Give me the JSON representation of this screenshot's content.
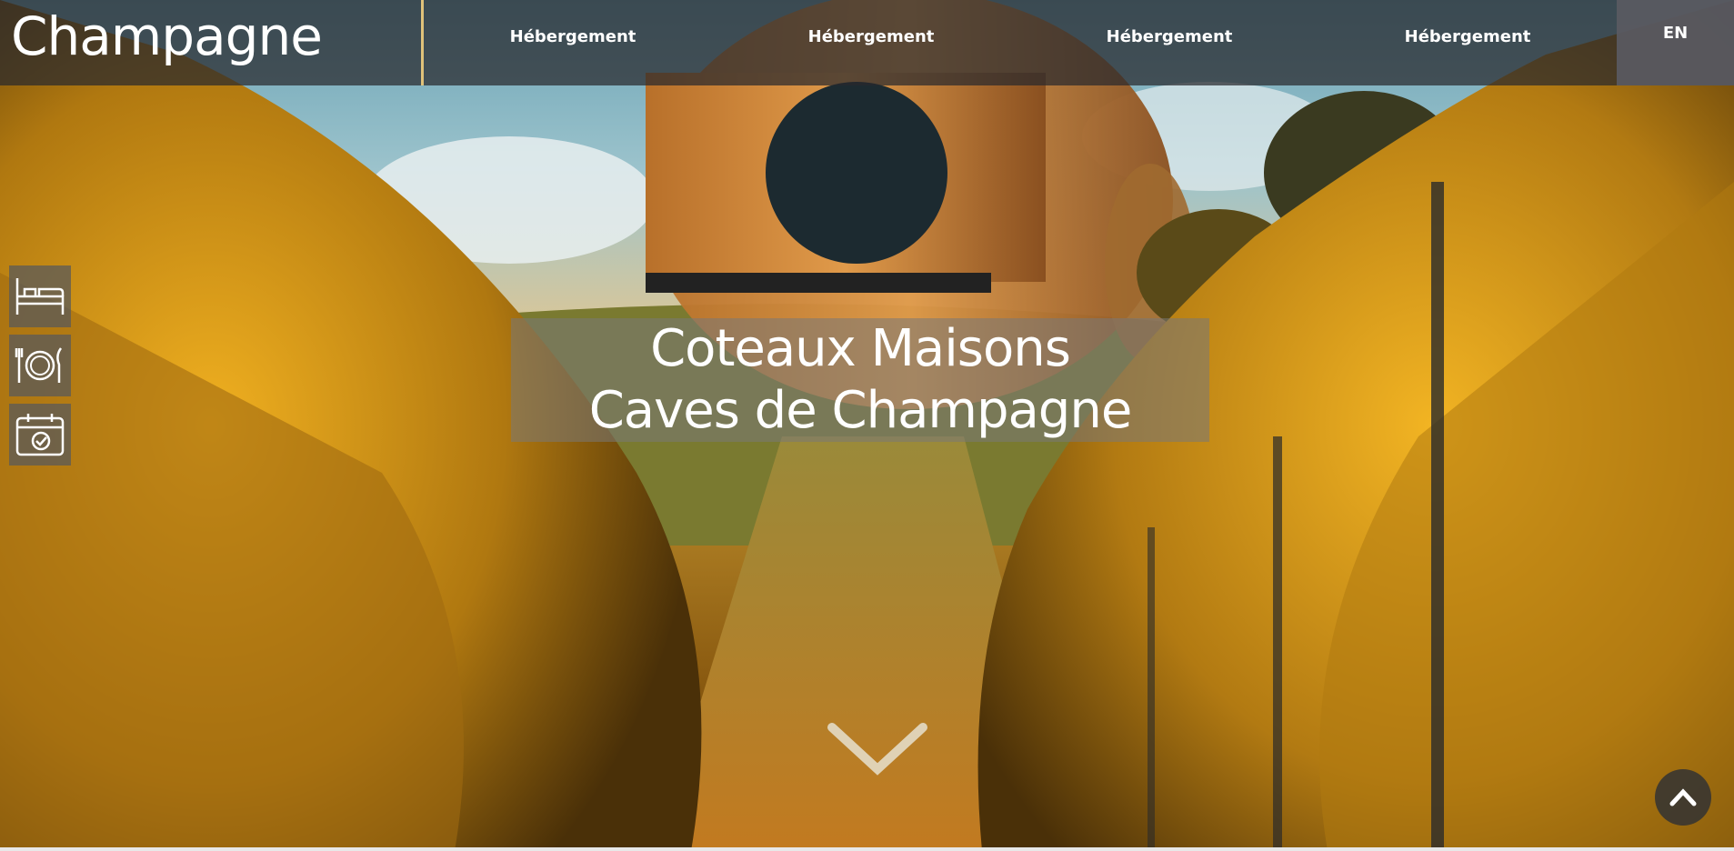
{
  "header": {
    "brand": "Champagne",
    "nav": [
      "Hébergement",
      "Hébergement",
      "Hébergement",
      "Hébergement"
    ],
    "lang": "EN"
  },
  "quick_links": [
    {
      "icon": "bed-icon"
    },
    {
      "icon": "plate-cutlery-icon"
    },
    {
      "icon": "calendar-check-icon"
    }
  ],
  "hero": {
    "title_line1": "Coteaux Maisons",
    "title_line2": "Caves de Champagne"
  },
  "controls": {
    "scroll_icon": "chevron-down-icon",
    "back_to_top_icon": "chevron-up-icon"
  },
  "colors": {
    "accent": "#e0c27a",
    "topbar": "#28282d",
    "vine": "#d79a12"
  }
}
